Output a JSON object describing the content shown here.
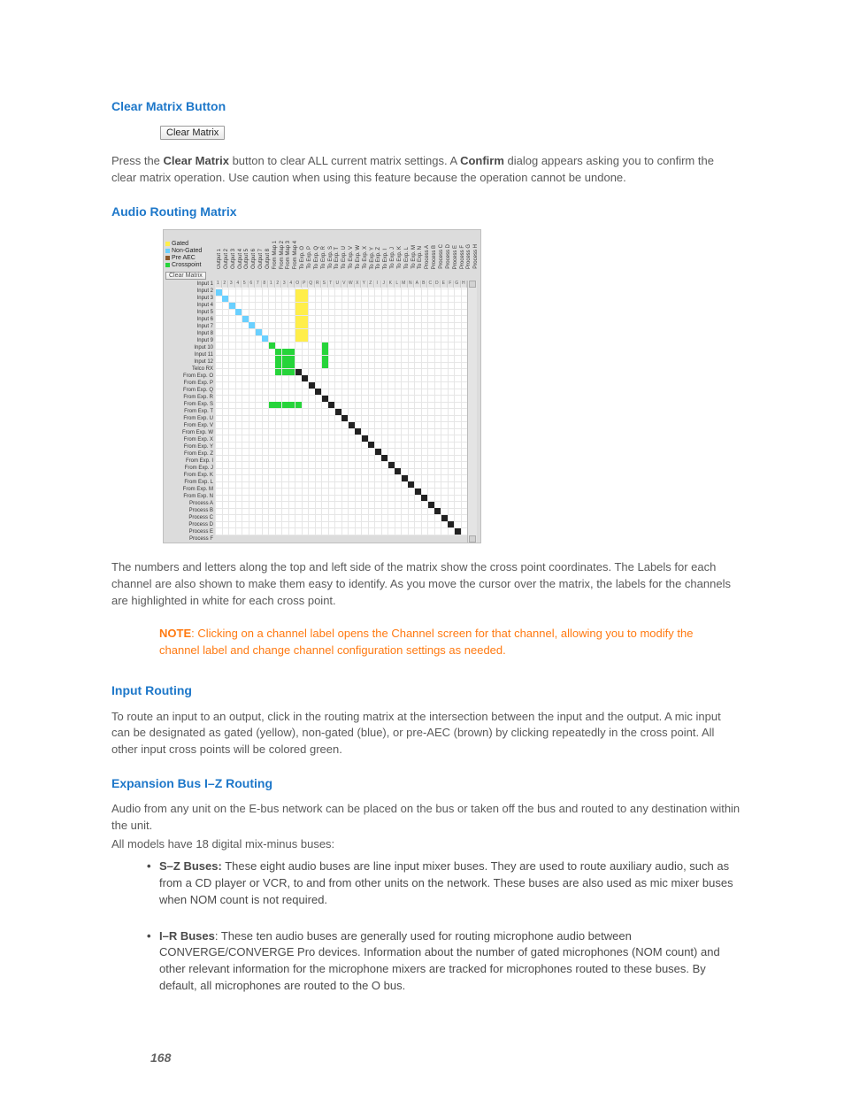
{
  "sections": {
    "clear_matrix_heading": "Clear Matrix Button",
    "audio_matrix_heading": "Audio Routing Matrix",
    "input_routing_heading": "Input Routing",
    "expansion_heading": "Expansion Bus I–Z Routing"
  },
  "buttons": {
    "clear_matrix": "Clear Matrix"
  },
  "paragraphs": {
    "clear_matrix_pre": "Press the ",
    "clear_matrix_bold1": "Clear Matrix",
    "clear_matrix_mid": " button to clear ALL current matrix settings. A ",
    "clear_matrix_bold2": "Confirm",
    "clear_matrix_post": " dialog appears asking you to confirm the clear matrix operation. Use caution when using this feature because the operation cannot be undone.",
    "matrix_desc": "The numbers and letters along the top and left side of the matrix show the cross point coordinates. The Labels for each channel are also shown to make them easy to identify. As you move the cursor over the matrix, the labels for the channels are highlighted in white for each cross point.",
    "input_routing": "To route an input to an output, click in the routing matrix at the intersection between the input and the output. A mic input can be designated as gated (yellow), non-gated (blue), or pre-AEC (brown) by clicking repeatedly in the cross point. All other input cross points will be colored green.",
    "expansion_p1": "Audio from any unit on the E-bus network can be placed on the bus or taken off the bus and routed to any destination within the unit.",
    "expansion_p2": "All models have 18 digital mix-minus buses:"
  },
  "note": {
    "label": "NOTE",
    "text": ": Clicking on a channel label opens the Channel screen for that channel, allowing you to modify the channel label and change channel configuration settings as needed."
  },
  "buses": {
    "sz_label": "S–Z Buses:",
    "sz_text": " These eight audio buses are line input mixer buses. They are used to route auxiliary audio, such as from a CD player or VCR, to and from other units on the network. These buses are also used as mic mixer buses when NOM count is not required.",
    "ir_label": "I–R Buses",
    "ir_text": ": These ten audio buses are generally used for routing microphone audio between CONVERGE/CONVERGE Pro devices. Information about the number of gated microphones (NOM count) and other relevant information for the microphone mixers are tracked for microphones routed to these buses. By default, all microphones are routed to the O bus."
  },
  "page_number": "168",
  "matrix": {
    "legend": {
      "gated": "Gated",
      "non_gated": "Non-Gated",
      "pre_aec": "Pre AEC",
      "crosspoint": "Crosspoint"
    },
    "clear_btn": "Clear Matrix",
    "columns": [
      "Output 1",
      "Output 2",
      "Output 3",
      "Output 4",
      "Output 5",
      "Output 6",
      "Output 7",
      "Output 8",
      "From Map 1",
      "From Map 2",
      "From Map 3",
      "From Map 4",
      "To Exp. O",
      "To Exp. P",
      "To Exp. Q",
      "To Exp. R",
      "To Exp. S",
      "To Exp. T",
      "To Exp. U",
      "To Exp. V",
      "To Exp. W",
      "To Exp. X",
      "To Exp. Y",
      "To Exp. Z",
      "To Exp. I",
      "To Exp. J",
      "To Exp. K",
      "To Exp. L",
      "To Exp. M",
      "To Exp. N",
      "Process A",
      "Process B",
      "Process C",
      "Process D",
      "Process E",
      "Process F",
      "Process G",
      "Process H"
    ],
    "col_headers": [
      "1",
      "2",
      "3",
      "4",
      "5",
      "6",
      "7",
      "8",
      "1",
      "2",
      "3",
      "4",
      "O",
      "P",
      "Q",
      "R",
      "S",
      "T",
      "U",
      "V",
      "W",
      "X",
      "Y",
      "Z",
      "I",
      "J",
      "K",
      "L",
      "M",
      "N",
      "A",
      "B",
      "C",
      "D",
      "E",
      "F",
      "G",
      "H"
    ],
    "rows": [
      "Input 1",
      "Input 2",
      "Input 3",
      "Input 4",
      "Input 5",
      "Input 6",
      "Input 7",
      "Input 8",
      "Input 9",
      "Input 10",
      "Input 11",
      "Input 12",
      "Telco RX",
      "From Exp. O",
      "From Exp. P",
      "From Exp. Q",
      "From Exp. R",
      "From Exp. S",
      "From Exp. T",
      "From Exp. U",
      "From Exp. V",
      "From Exp. W",
      "From Exp. X",
      "From Exp. Y",
      "From Exp. Z",
      "From Exp. I",
      "From Exp. J",
      "From Exp. K",
      "From Exp. L",
      "From Exp. M",
      "From Exp. N",
      "Process A",
      "Process B",
      "Process C",
      "Process D",
      "Process E",
      "Process F"
    ],
    "row_headers": [
      "1",
      "2",
      "3",
      "4",
      "5",
      "6",
      "7",
      "8",
      "9",
      "10",
      "11",
      "12",
      "R",
      "O",
      "P",
      "Q",
      "R",
      "S",
      "T",
      "U",
      "V",
      "W",
      "X",
      "Y",
      "Z",
      "I",
      "J",
      "K",
      "L",
      "M",
      "N",
      "A",
      "B",
      "C",
      "D",
      "E",
      "F"
    ],
    "crosspoints": [
      {
        "r": 0,
        "c": 0,
        "t": "bl"
      },
      {
        "r": 1,
        "c": 1,
        "t": "bl"
      },
      {
        "r": 2,
        "c": 2,
        "t": "bl"
      },
      {
        "r": 3,
        "c": 3,
        "t": "bl"
      },
      {
        "r": 4,
        "c": 4,
        "t": "bl"
      },
      {
        "r": 5,
        "c": 5,
        "t": "bl"
      },
      {
        "r": 6,
        "c": 6,
        "t": "bl"
      },
      {
        "r": 7,
        "c": 7,
        "t": "bl"
      },
      {
        "r": 0,
        "c": 12,
        "t": "y"
      },
      {
        "r": 1,
        "c": 12,
        "t": "y"
      },
      {
        "r": 2,
        "c": 12,
        "t": "y"
      },
      {
        "r": 3,
        "c": 12,
        "t": "y"
      },
      {
        "r": 4,
        "c": 12,
        "t": "y"
      },
      {
        "r": 5,
        "c": 12,
        "t": "y"
      },
      {
        "r": 6,
        "c": 12,
        "t": "y"
      },
      {
        "r": 7,
        "c": 12,
        "t": "y"
      },
      {
        "r": 0,
        "c": 13,
        "t": "y"
      },
      {
        "r": 1,
        "c": 13,
        "t": "y"
      },
      {
        "r": 2,
        "c": 13,
        "t": "y"
      },
      {
        "r": 3,
        "c": 13,
        "t": "y"
      },
      {
        "r": 4,
        "c": 13,
        "t": "y"
      },
      {
        "r": 5,
        "c": 13,
        "t": "y"
      },
      {
        "r": 6,
        "c": 13,
        "t": "y"
      },
      {
        "r": 7,
        "c": 13,
        "t": "y"
      },
      {
        "r": 8,
        "c": 8,
        "t": "gr"
      },
      {
        "r": 8,
        "c": 16,
        "t": "gr"
      },
      {
        "r": 9,
        "c": 9,
        "t": "gr"
      },
      {
        "r": 9,
        "c": 10,
        "t": "gr"
      },
      {
        "r": 9,
        "c": 11,
        "t": "gr"
      },
      {
        "r": 9,
        "c": 16,
        "t": "gr"
      },
      {
        "r": 10,
        "c": 9,
        "t": "gr"
      },
      {
        "r": 10,
        "c": 10,
        "t": "gr"
      },
      {
        "r": 10,
        "c": 11,
        "t": "gr"
      },
      {
        "r": 10,
        "c": 16,
        "t": "gr"
      },
      {
        "r": 11,
        "c": 9,
        "t": "gr"
      },
      {
        "r": 11,
        "c": 10,
        "t": "gr"
      },
      {
        "r": 11,
        "c": 11,
        "t": "gr"
      },
      {
        "r": 11,
        "c": 16,
        "t": "gr"
      },
      {
        "r": 12,
        "c": 9,
        "t": "gr"
      },
      {
        "r": 12,
        "c": 10,
        "t": "gr"
      },
      {
        "r": 12,
        "c": 11,
        "t": "gr"
      },
      {
        "r": 17,
        "c": 8,
        "t": "gr"
      },
      {
        "r": 17,
        "c": 9,
        "t": "gr"
      },
      {
        "r": 17,
        "c": 10,
        "t": "gr"
      },
      {
        "r": 17,
        "c": 11,
        "t": "gr"
      },
      {
        "r": 17,
        "c": 12,
        "t": "gr"
      }
    ],
    "diagonal_start_row": 12,
    "diagonal_start_col": 12,
    "diagonal_len": 25
  }
}
